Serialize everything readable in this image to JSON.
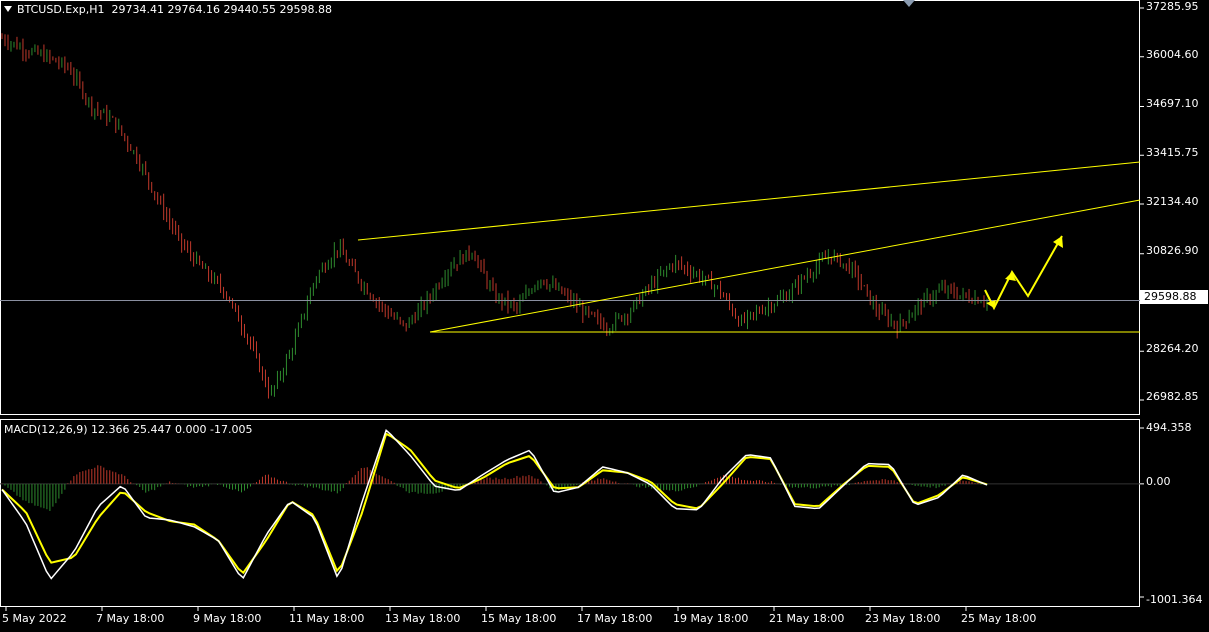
{
  "header": {
    "symbol": "BTCUSD.Exp,H1",
    "ohlc": "29734.41 29764.16 29440.55 29598.88"
  },
  "current_price": "29598.88",
  "price_axis": [
    "37285.95",
    "36004.60",
    "34697.10",
    "33415.75",
    "32134.40",
    "30826.90",
    "28264.20",
    "26982.85"
  ],
  "time_axis": [
    "5 May 2022",
    "7 May 18:00",
    "9 May 18:00",
    "11 May 18:00",
    "13 May 18:00",
    "15 May 18:00",
    "17 May 18:00",
    "19 May 18:00",
    "21 May 18:00",
    "23 May 18:00",
    "25 May 18:00"
  ],
  "macd": {
    "label": "MACD(12,26,9) 12.366 25.447 0.000 -17.005",
    "axis": [
      "494.358",
      "0.00",
      "-1001.364"
    ]
  },
  "colors": {
    "background": "#000000",
    "bull": "#2e8b2e",
    "bear": "#c0392b",
    "trendline": "#ffff00",
    "signal": "#ffff00",
    "macd_line": "#ffffff",
    "grid": "#ffffff"
  },
  "chart_data": [
    {
      "type": "line",
      "title": "BTCUSD.Exp,H1",
      "ylim": [
        26600,
        37300
      ],
      "x_labels": [
        "5 May 2022",
        "7 May 18:00",
        "9 May 18:00",
        "11 May 18:00",
        "13 May 18:00",
        "15 May 18:00",
        "17 May 18:00",
        "19 May 18:00",
        "21 May 18:00",
        "23 May 18:00",
        "25 May 18:00"
      ],
      "price_path": [
        36500,
        36200,
        36000,
        35700,
        34700,
        34300,
        33400,
        32200,
        31100,
        30400,
        29800,
        28600,
        27100,
        28400,
        30200,
        31000,
        30100,
        29400,
        28900,
        29600,
        30500,
        30900,
        29700,
        29400,
        30200,
        29800,
        29300,
        28900,
        29300,
        30000,
        30600,
        30300,
        29900,
        29000,
        29400,
        29700,
        30300,
        30800,
        30400,
        29400,
        28900,
        29500,
        29900,
        29700,
        29600
      ],
      "levels": {
        "last": 29598.88,
        "support": 28900
      },
      "trendlines": [
        {
          "from": [
            "12 May 18:00",
            30850
          ],
          "to": [
            "27 May",
            33400
          ]
        },
        {
          "from": [
            "13 May 06:00",
            28900
          ],
          "to": [
            "27 May",
            32200
          ]
        },
        {
          "from": [
            "13 May 06:00",
            28900
          ],
          "to": [
            "27 May",
            28900
          ]
        }
      ],
      "projection": [
        29600,
        29400,
        30000,
        29500,
        30800
      ]
    },
    {
      "type": "bar",
      "title": "MACD(12,26,9)",
      "ylim": [
        -1001.364,
        494.358
      ],
      "values": {
        "macd": 12.366,
        "signal": 25.447,
        "hist_pos": 0.0,
        "hist_neg": -17.005
      },
      "macd_path": [
        -50,
        -350,
        -850,
        -600,
        -200,
        -10,
        -300,
        -320,
        -380,
        -500,
        -850,
        -450,
        -150,
        -300,
        -850,
        -150,
        480,
        250,
        -20,
        -60,
        80,
        210,
        300,
        -80,
        -30,
        150,
        100,
        -5,
        -220,
        -230,
        50,
        260,
        230,
        -200,
        -220,
        -20,
        180,
        170,
        -190,
        -120,
        80,
        -10
      ],
      "signal_path": [
        -50,
        -250,
        -700,
        -650,
        -300,
        -60,
        -250,
        -330,
        -360,
        -500,
        -800,
        -500,
        -150,
        -280,
        -800,
        -250,
        450,
        300,
        30,
        -40,
        50,
        180,
        250,
        -40,
        -30,
        120,
        100,
        20,
        -180,
        -220,
        0,
        240,
        220,
        -180,
        -200,
        -10,
        160,
        150,
        -180,
        -100,
        60,
        -5
      ]
    }
  ]
}
